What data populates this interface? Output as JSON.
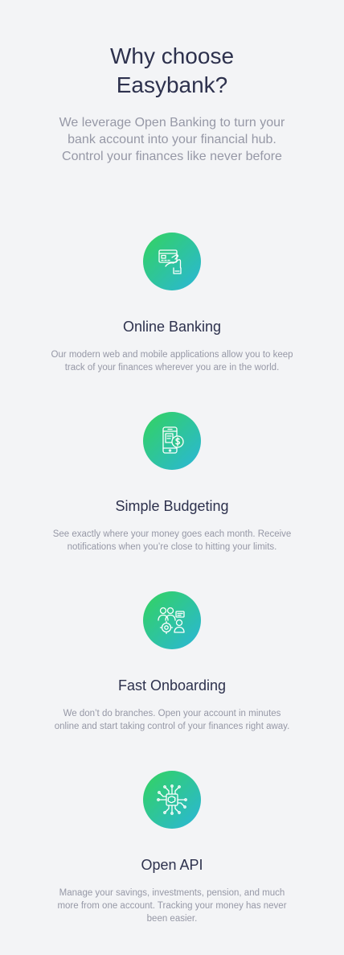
{
  "section": {
    "heading_line1": "Why choose",
    "heading_line2": "Easybank?",
    "intro": "We leverage Open Banking to turn your bank account into your financial hub. Control your finances like never before"
  },
  "features": [
    {
      "icon": "online-banking-icon",
      "title": "Online Banking",
      "text": "Our modern web and mobile applications allow you to keep track of your finances wherever you are in the world."
    },
    {
      "icon": "budgeting-icon",
      "title": "Simple Budgeting",
      "text": "See exactly where your money goes each month. Receive notifications when you’re close to hitting your limits."
    },
    {
      "icon": "onboarding-icon",
      "title": "Fast Onboarding",
      "text": "We don’t do branches. Open your account in minutes online and start taking control of your finances right away."
    },
    {
      "icon": "api-icon",
      "title": "Open API",
      "text": "Manage your savings, investments, pension, and much more from one account. Tracking your money has never been easier."
    }
  ],
  "colors": {
    "background": "#f3f4f6",
    "heading": "#2d314d",
    "body_text": "#9698a6",
    "gradient_start": "#33d35e",
    "gradient_end": "#2ab6d9"
  }
}
